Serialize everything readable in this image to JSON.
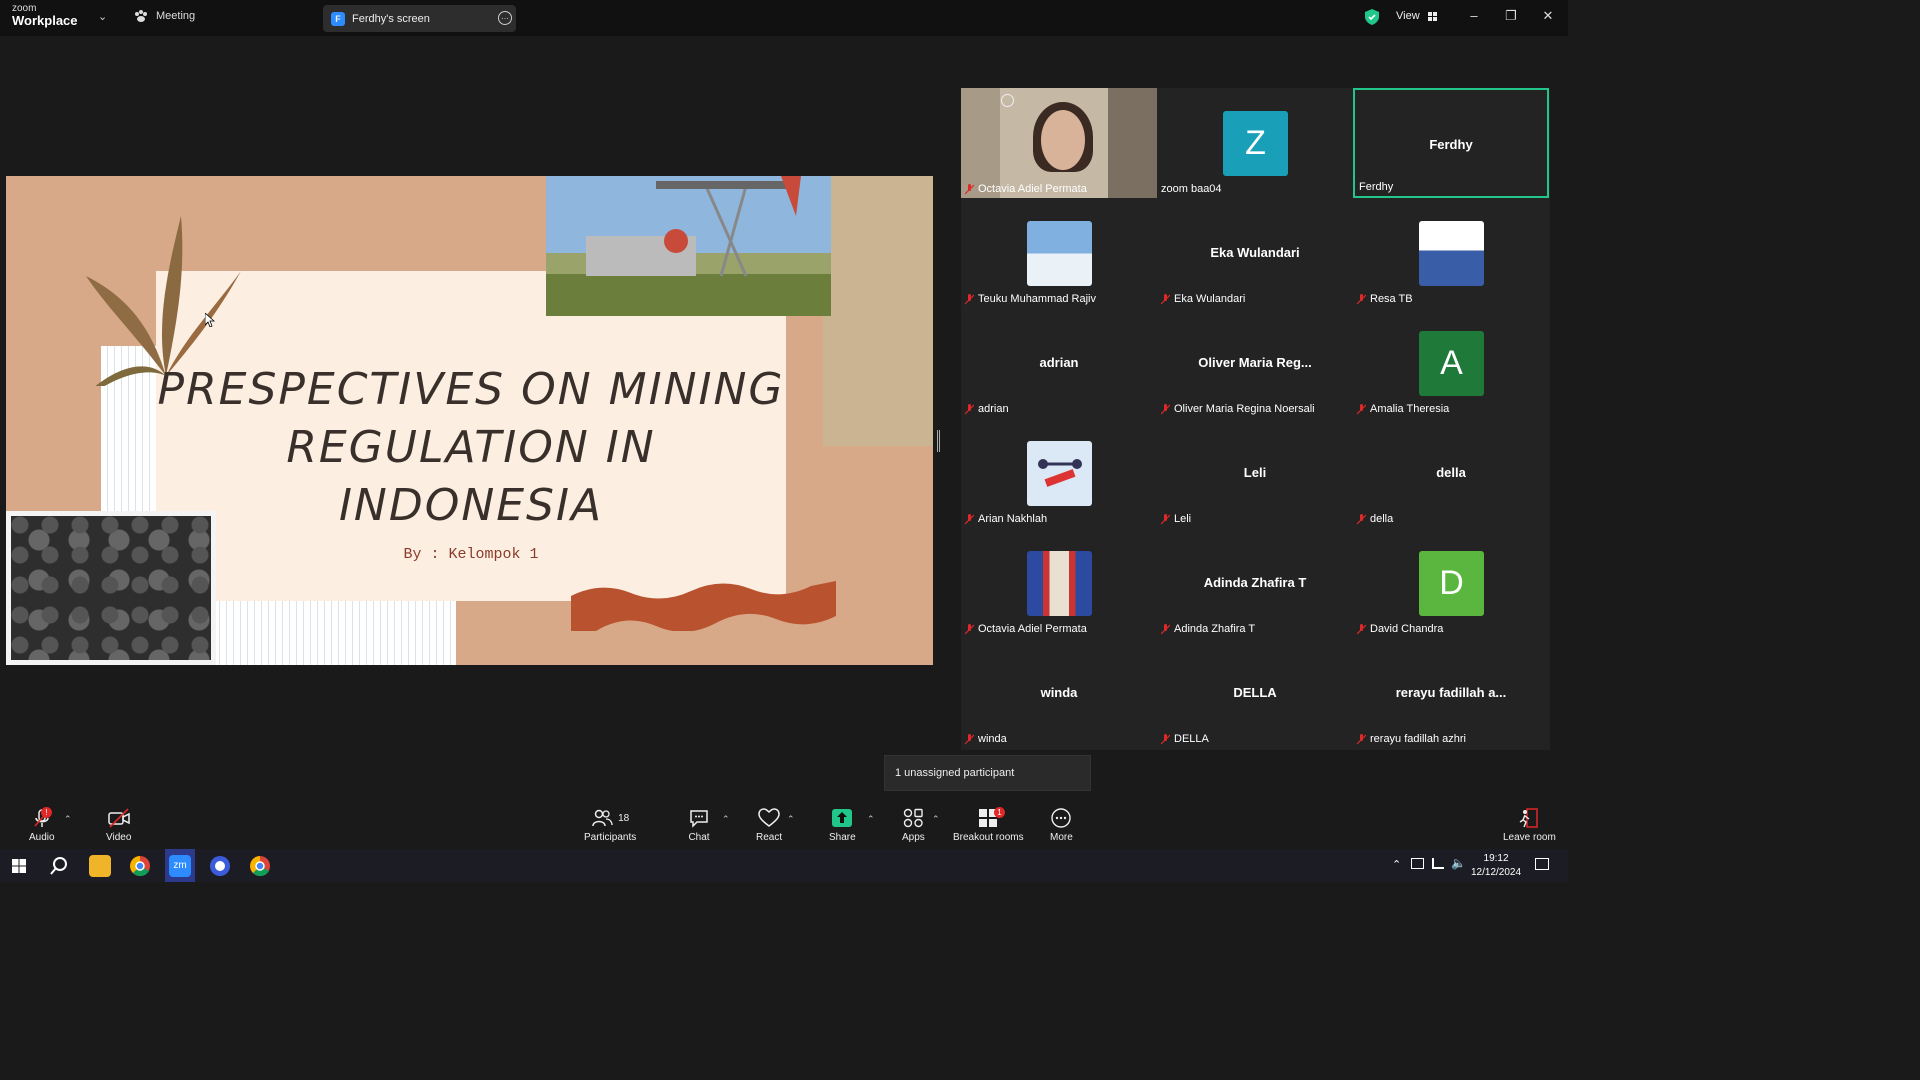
{
  "titlebar": {
    "logo_line1": "zoom",
    "logo_line2": "Workplace",
    "meeting_label": "Meeting",
    "screen_badge": "F",
    "screen_label": "Ferdhy's screen",
    "view_label": "View"
  },
  "slide": {
    "title_line1": "PRESPECTIVES ON MINING",
    "title_line2": "REGULATION IN INDONESIA",
    "subtitle": "By : Kelompok 1"
  },
  "gallery": {
    "tiles": [
      {
        "label": "Octavia Adiel Permata"
      },
      {
        "label": "zoom baa04",
        "avatar": "Z"
      },
      {
        "label": "Ferdhy",
        "big": "Ferdhy"
      },
      {
        "label": "Teuku Muhammad Rajiv"
      },
      {
        "label": "Eka Wulandari",
        "big": "Eka Wulandari"
      },
      {
        "label": "Resa TB"
      },
      {
        "label": "adrian",
        "big": "adrian"
      },
      {
        "label": "Oliver Maria Regina Noersali",
        "big": "Oliver Maria Reg..."
      },
      {
        "label": "Amalia Theresia",
        "avatar": "A"
      },
      {
        "label": "Arian Nakhlah"
      },
      {
        "label": "Leli",
        "big": "Leli"
      },
      {
        "label": "della",
        "big": "della"
      },
      {
        "label": "Octavia Adiel Permata"
      },
      {
        "label": "Adinda Zhafira T",
        "big": "Adinda Zhafira T"
      },
      {
        "label": "David Chandra",
        "avatar": "D"
      },
      {
        "label": "winda",
        "big": "winda"
      },
      {
        "label": "DELLA",
        "big": "DELLA"
      },
      {
        "label": "rerayu fadillah azhri",
        "big": "rerayu fadillah a..."
      }
    ]
  },
  "unassigned": "1 unassigned participant",
  "toolbar": {
    "audio": "Audio",
    "video": "Video",
    "participants": "Participants",
    "participants_count": "18",
    "chat": "Chat",
    "react": "React",
    "share": "Share",
    "apps": "Apps",
    "breakout": "Breakout rooms",
    "breakout_badge": "1",
    "more": "More",
    "leave": "Leave room"
  },
  "taskbar": {
    "time": "19:12",
    "date": "12/12/2024",
    "zoom_label": "zm"
  },
  "colors": {
    "accent_green": "#21c78a",
    "zoom_blue": "#2d8cff",
    "avatar_teal": "#1a9fb8",
    "avatar_green_dark": "#1f7a3a",
    "avatar_green": "#5bb63f",
    "mute_red": "#e02828"
  }
}
